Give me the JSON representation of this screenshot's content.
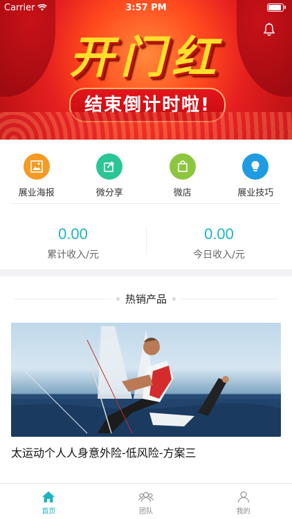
{
  "status_bar": {
    "carrier": "Carrier",
    "time": "3:57 PM"
  },
  "banner": {
    "title": "开门红",
    "subtitle": "结束倒计时啦!"
  },
  "menu": [
    {
      "label": "展业海报",
      "icon": "poster-icon",
      "color": "#f59a22"
    },
    {
      "label": "微分享",
      "icon": "share-icon",
      "color": "#2cc696"
    },
    {
      "label": "微店",
      "icon": "shop-icon",
      "color": "#8cc63f"
    },
    {
      "label": "展业技巧",
      "icon": "lightbulb-icon",
      "color": "#1f9be2"
    }
  ],
  "stats": {
    "total": {
      "value": "0.00",
      "label": "累计收入/元"
    },
    "today": {
      "value": "0.00",
      "label": "今日收入/元"
    }
  },
  "section": {
    "title": "热销产品"
  },
  "product": {
    "title": "太运动个人人身意外险-低风险-方案三"
  },
  "tabs": [
    {
      "label": "首页",
      "icon": "home-icon",
      "active": true
    },
    {
      "label": "团队",
      "icon": "team-icon",
      "active": false
    },
    {
      "label": "我的",
      "icon": "profile-icon",
      "active": false
    }
  ],
  "colors": {
    "accent": "#1cb5c0"
  }
}
